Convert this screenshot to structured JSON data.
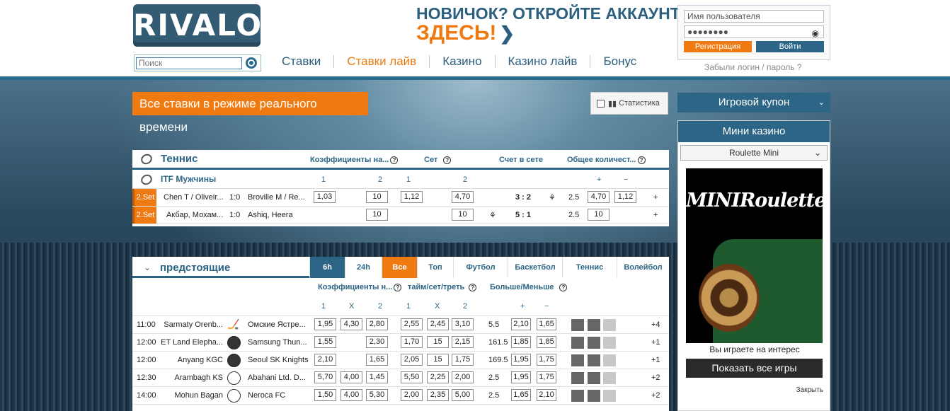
{
  "header": {
    "logo": "RIVALO",
    "search_placeholder": "Поиск",
    "promo_line1": "НОВИЧОК? ОТКРОЙТЕ АККАУНТ",
    "promo_line2": "ЗДЕСЬ!",
    "nav": [
      "Ставки",
      "Ставки лайв",
      "Казино",
      "Казино лайв",
      "Бонус"
    ],
    "active_nav": "Ставки лайв",
    "login": {
      "username_placeholder": "Имя пользователя",
      "password_mask": "●●●●●●●●",
      "register_label": "Регистрация",
      "login_label": "Войти",
      "forgot_label": "Забыли логин / пароль ?"
    }
  },
  "live": {
    "banner": "Все ставки в режиме реального времени",
    "stats_label": "Статистика"
  },
  "tennis": {
    "title": "Теннис",
    "col_odds": "Коэффициенты на...",
    "col_set": "Сет",
    "col_score": "Счет в сете",
    "col_total": "Общее количест...",
    "league": "ITF Мужчины",
    "sub_cols": [
      "1",
      "2",
      "1",
      "2",
      "+",
      "−"
    ],
    "rows": [
      {
        "set": "2.Set",
        "home": "Chen T / Oliveir...",
        "score": "1:0",
        "away": "Broville M / Re...",
        "o1": "1,03",
        "o2": "10",
        "s1": "1,12",
        "s2": "4,70",
        "game": "3 : 2",
        "line": "2.5",
        "tp": "4,70",
        "tm": "1,12",
        "more": "+"
      },
      {
        "set": "2.Set",
        "home": "Акбар, Мохам...",
        "score": "1:0",
        "away": "Ashiq, Heera",
        "o1": "",
        "o2": "10",
        "s1": "",
        "s2": "10",
        "game": "5 : 1",
        "line": "2.5",
        "tp": "10",
        "tm": "",
        "more": "+"
      }
    ]
  },
  "upcoming": {
    "title": "предстоящие",
    "tabs": [
      "6h",
      "24h",
      "Все",
      "Топ",
      "Футбол",
      "Баскетбол",
      "Теннис",
      "Волейбол"
    ],
    "col_odds": "Коэффициенты н...",
    "col_period": "тайм/сет/треть",
    "col_ou": "Больше/Меньше",
    "sub_cols": [
      "1",
      "X",
      "2",
      "1",
      "X",
      "2",
      "+",
      "−"
    ],
    "rows": [
      {
        "time": "11:00",
        "home": "Sarmaty Orenb...",
        "away": "Омские Ястре...",
        "sport": "hockey",
        "o": [
          "1,95",
          "4,30",
          "2,80",
          "2,55",
          "2,45",
          "3,10"
        ],
        "line": "5.5",
        "ou": [
          "2,10",
          "1,65"
        ],
        "more": "+4"
      },
      {
        "time": "12:00",
        "home": "ET Land Elepha...",
        "away": "Samsung Thun...",
        "sport": "basketball",
        "o": [
          "1,55",
          "",
          "2,30",
          "1,70",
          "15",
          "2,15"
        ],
        "line": "161.5",
        "ou": [
          "1,85",
          "1,85"
        ],
        "more": "+1"
      },
      {
        "time": "12:00",
        "home": "Anyang KGC",
        "away": "Seoul SK Knights",
        "sport": "basketball",
        "o": [
          "2,10",
          "",
          "1,65",
          "2,05",
          "15",
          "1,75"
        ],
        "line": "169.5",
        "ou": [
          "1,95",
          "1,75"
        ],
        "more": "+1"
      },
      {
        "time": "12:30",
        "home": "Arambagh KS",
        "away": "Abahani Ltd. D...",
        "sport": "football",
        "o": [
          "5,70",
          "4,00",
          "1,45",
          "5,50",
          "2,25",
          "2,00"
        ],
        "line": "2.5",
        "ou": [
          "1,95",
          "1,75"
        ],
        "more": "+2"
      },
      {
        "time": "14:00",
        "home": "Mohun Bagan",
        "away": "Neroca FC",
        "sport": "football",
        "o": [
          "1,50",
          "4,00",
          "5,30",
          "2,00",
          "2,35",
          "5,00"
        ],
        "line": "2.5",
        "ou": [
          "1,65",
          "2,10"
        ],
        "more": "+2"
      }
    ]
  },
  "sidebar": {
    "coupon": "Игровой купон",
    "mini_title": "Мини казино",
    "game_select": "Roulette Mini",
    "game_name": "MINIRoulette",
    "play_note": "Вы играете на интерес",
    "show_all": "Показать все игры",
    "close": "Закрыть"
  }
}
